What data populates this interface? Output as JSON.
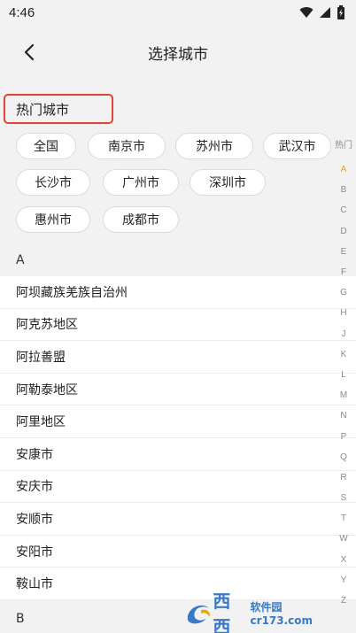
{
  "status_bar": {
    "time": "4:46"
  },
  "header": {
    "title": "选择城市"
  },
  "hot": {
    "title": "热门城市",
    "cities": [
      "全国",
      "南京市",
      "苏州市",
      "武汉市",
      "长沙市",
      "广州市",
      "深圳市",
      "惠州市",
      "成都市"
    ]
  },
  "sections": [
    {
      "letter": "A",
      "cities": [
        "阿坝藏族羌族自治州",
        "阿克苏地区",
        "阿拉善盟",
        "阿勒泰地区",
        "阿里地区",
        "安康市",
        "安庆市",
        "安顺市",
        "安阳市",
        "鞍山市"
      ]
    },
    {
      "letter": "B",
      "cities": []
    }
  ],
  "index_bar": {
    "hot": "热门",
    "letters": [
      "A",
      "B",
      "C",
      "D",
      "E",
      "F",
      "G",
      "H",
      "J",
      "K",
      "L",
      "M",
      "N",
      "P",
      "Q",
      "R",
      "S",
      "T",
      "W",
      "X",
      "Y",
      "Z"
    ],
    "active": "A",
    "active_color": "#f0a500"
  },
  "watermark": {
    "logo": "西西",
    "sub": "软件园 cr173.com"
  },
  "colors": {
    "highlight_border": "#e0453a",
    "background": "#f2f2f2"
  }
}
